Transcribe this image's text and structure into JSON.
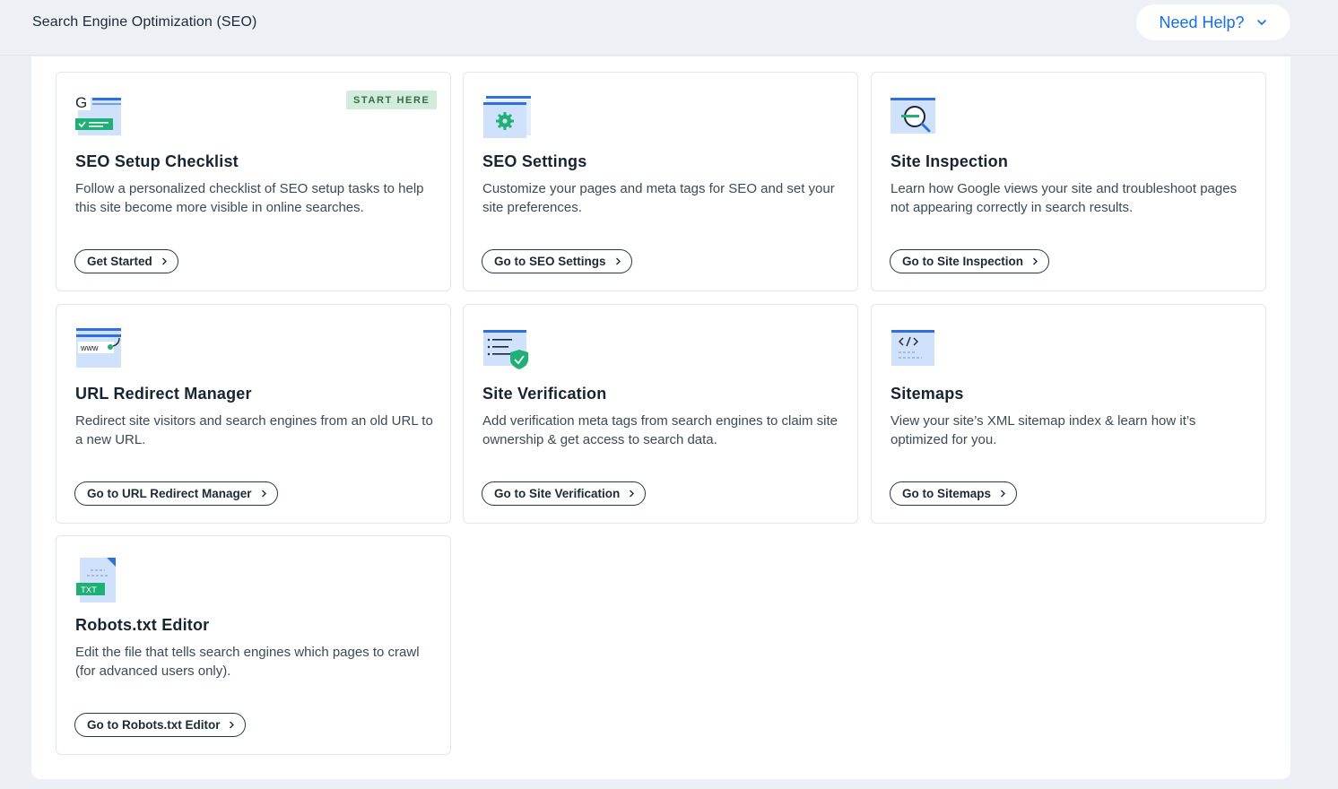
{
  "header": {
    "title": "Search Engine Optimization (SEO)",
    "help_label": "Need Help?"
  },
  "colors": {
    "accent": "#116dff",
    "badge_bg": "#d2ecdb",
    "icon_blue": "#2f6fe0",
    "icon_green": "#1fb075"
  },
  "cards": [
    {
      "icon": "seo-checklist-icon",
      "title": "SEO Setup Checklist",
      "badge": "START HERE",
      "description": "Follow a personalized checklist of SEO setup tasks to help this site become more visible in online searches.",
      "button": "Get Started"
    },
    {
      "icon": "seo-settings-icon",
      "title": "SEO Settings",
      "description": "Customize your pages and meta tags for SEO and set your site preferences.",
      "button": "Go to SEO Settings"
    },
    {
      "icon": "site-inspection-icon",
      "title": "Site Inspection",
      "description": "Learn how Google views your site and troubleshoot pages not appearing correctly in search results.",
      "button": "Go to Site Inspection"
    },
    {
      "icon": "url-redirect-icon",
      "title": "URL Redirect Manager",
      "description": "Redirect site visitors and search engines from an old URL to a new URL.",
      "button": "Go to URL Redirect Manager"
    },
    {
      "icon": "site-verification-icon",
      "title": "Site Verification",
      "description": "Add verification meta tags from search engines to claim site ownership & get access to search data.",
      "button": "Go to Site Verification"
    },
    {
      "icon": "sitemaps-icon",
      "title": "Sitemaps",
      "description": "View your site’s XML sitemap index & learn how it’s optimized for you.",
      "button": "Go to Sitemaps"
    },
    {
      "icon": "robots-txt-icon",
      "title": "Robots.txt Editor",
      "description": "Edit the file that tells search engines which pages to crawl (for advanced users only).",
      "button": "Go to Robots.txt Editor"
    }
  ]
}
